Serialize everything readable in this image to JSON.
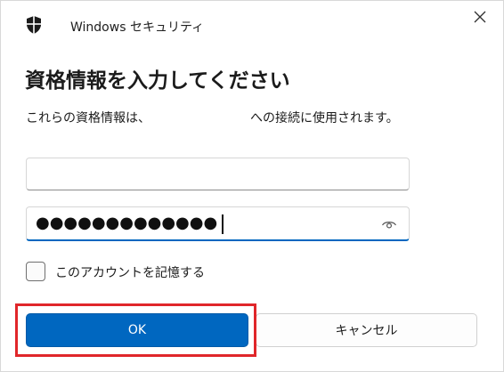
{
  "window": {
    "title": "Windows セキュリティ",
    "icon": "shield-icon",
    "close_icon": "close-icon"
  },
  "dialog": {
    "heading": "資格情報を入力してください",
    "description_prefix": "これらの資格情報は、",
    "description_suffix": "への接続に使用されます。"
  },
  "form": {
    "username_value": "",
    "password_mask": "●●●●●●●●●●●●●",
    "reveal_icon": "eye-icon",
    "remember_label": "このアカウントを記憶する",
    "remember_checked": false
  },
  "buttons": {
    "ok_label": "OK",
    "cancel_label": "キャンセル"
  },
  "colors": {
    "accent": "#0067c0",
    "highlight": "#e0262a"
  }
}
